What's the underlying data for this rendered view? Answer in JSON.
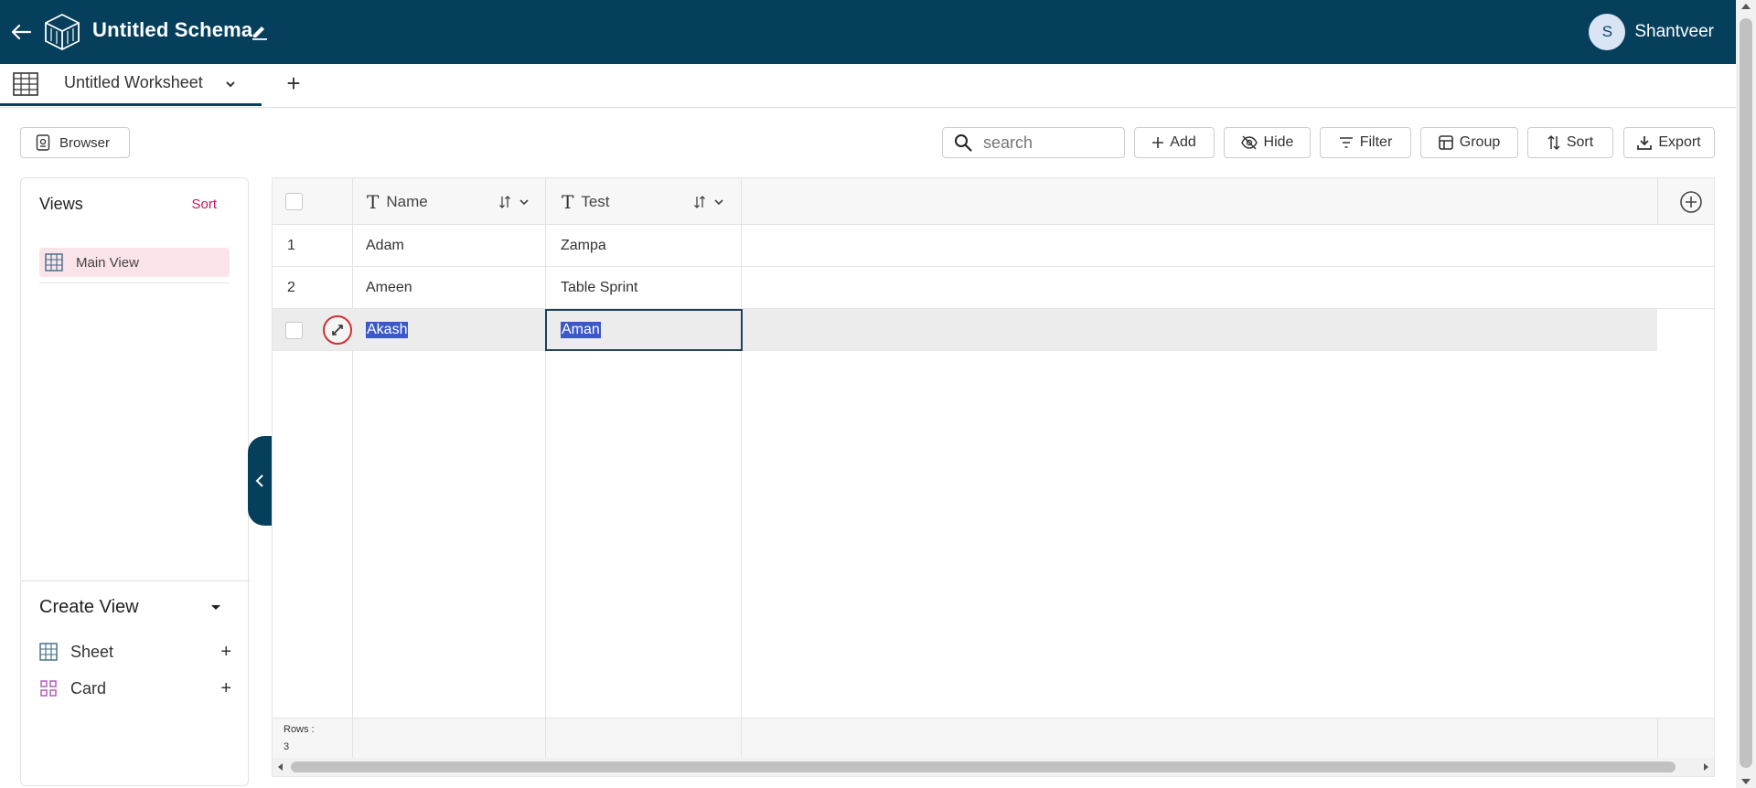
{
  "header": {
    "schema_title": "Untitled Schema",
    "user_initial": "S",
    "user_name": "Shantveer"
  },
  "tabs": {
    "worksheet_label": "Untitled Worksheet",
    "add_label": "+"
  },
  "toolbar": {
    "browser_label": "Browser",
    "search_placeholder": "search",
    "add_label": "Add",
    "hide_label": "Hide",
    "filter_label": "Filter",
    "group_label": "Group",
    "sort_label": "Sort",
    "export_label": "Export"
  },
  "sidebar": {
    "views_title": "Views",
    "views_sort": "Sort",
    "views": [
      {
        "label": "Main View",
        "icon": "grid-icon"
      }
    ],
    "create_view_title": "Create View",
    "create_items": [
      {
        "label": "Sheet",
        "icon": "grid-icon",
        "plus": "+"
      },
      {
        "label": "Card",
        "icon": "card-grid-icon",
        "plus": "+"
      }
    ]
  },
  "grid": {
    "columns": [
      {
        "label": "Name",
        "type_icon": "T"
      },
      {
        "label": "Test",
        "type_icon": "T"
      }
    ],
    "rows": [
      {
        "num": "1",
        "name": "Adam",
        "test": "Zampa"
      },
      {
        "num": "2",
        "name": "Ameen",
        "test": "Table Sprint"
      },
      {
        "num": "",
        "name": "Akash",
        "test": "Aman"
      }
    ],
    "rows_label": "Rows :",
    "rows_count": "3"
  },
  "colors": {
    "topbar": "#053f5c",
    "accent_pink": "#c2185b",
    "selection": "#3b57c9"
  }
}
